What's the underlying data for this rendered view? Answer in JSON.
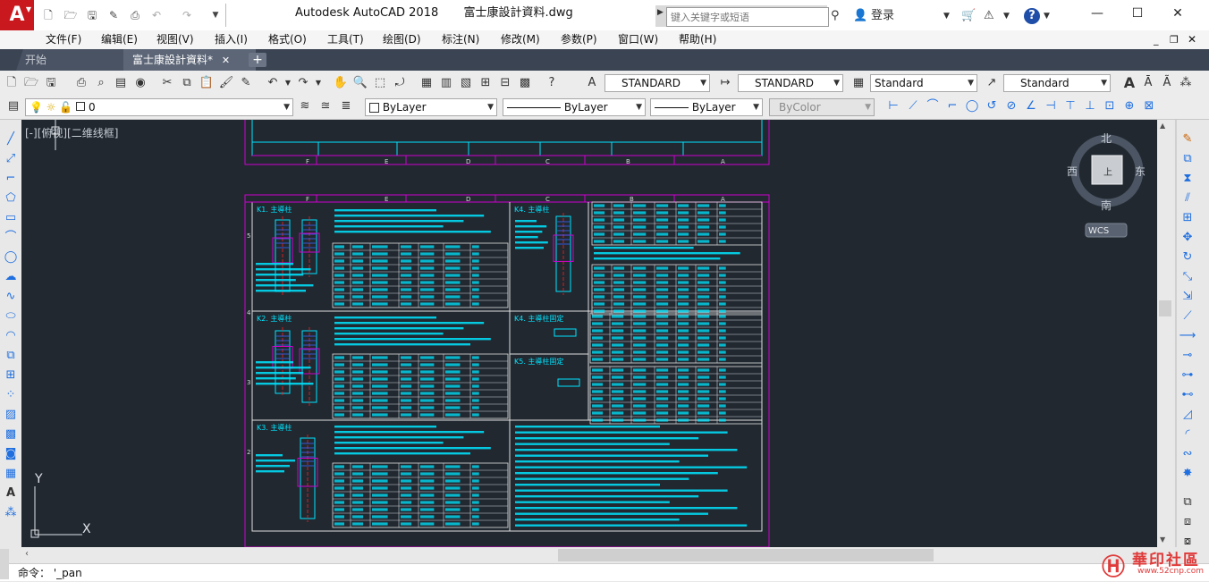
{
  "app": {
    "logo_letter": "A",
    "title_app": "Autodesk AutoCAD 2018",
    "title_doc": "富士康設計資料.dwg"
  },
  "search": {
    "placeholder": "键入关键字或短语"
  },
  "account": {
    "login_label": "登录"
  },
  "menu": [
    "文件(F)",
    "编辑(E)",
    "视图(V)",
    "插入(I)",
    "格式(O)",
    "工具(T)",
    "绘图(D)",
    "标注(N)",
    "修改(M)",
    "参数(P)",
    "窗口(W)",
    "帮助(H)"
  ],
  "tabs": {
    "start": "开始",
    "doc": "富士康設計資料*"
  },
  "styles": {
    "text_style": "STANDARD",
    "dim_style": "STANDARD",
    "table_style": "Standard",
    "mleader_style": "Standard"
  },
  "layers": {
    "current_layer": "0"
  },
  "properties": {
    "color": "ByLayer",
    "linetype": "ByLayer",
    "lineweight": "ByLayer",
    "plotstyle": "ByColor"
  },
  "viewport": {
    "label": "[-][俯视][二维线框]"
  },
  "viewcube": {
    "north": "北",
    "south": "南",
    "east": "东",
    "west": "西",
    "center": "上",
    "wcs": "WCS"
  },
  "ucs": {
    "x_label": "X",
    "y_label": "Y"
  },
  "command": {
    "text": "命令： '_pan"
  },
  "watermark": {
    "text": "華印社區",
    "sub": "www.52cnp.com"
  },
  "drawing": {
    "top_strip_letters": [
      "F",
      "E",
      "D",
      "C",
      "B",
      "A"
    ],
    "section_letters": [
      "F",
      "E",
      "D",
      "C",
      "B",
      "A"
    ],
    "row_numbers": [
      "5",
      "4",
      "3",
      "2"
    ],
    "blocks": [
      {
        "label": "K1. 主導柱"
      },
      {
        "label": "K2. 主導柱"
      },
      {
        "label": "K3. 主導柱"
      },
      {
        "label": "K4. 主導柱"
      },
      {
        "label": "K4. 主導柱固定"
      },
      {
        "label": "K5. 主導柱固定"
      }
    ]
  },
  "colors": {
    "canvas": "#212830",
    "cyan": "#00e5ff",
    "magenta": "#d000d0",
    "red": "#ff2020",
    "blue": "#3b66ff",
    "titlebar_red": "#c9181e"
  }
}
